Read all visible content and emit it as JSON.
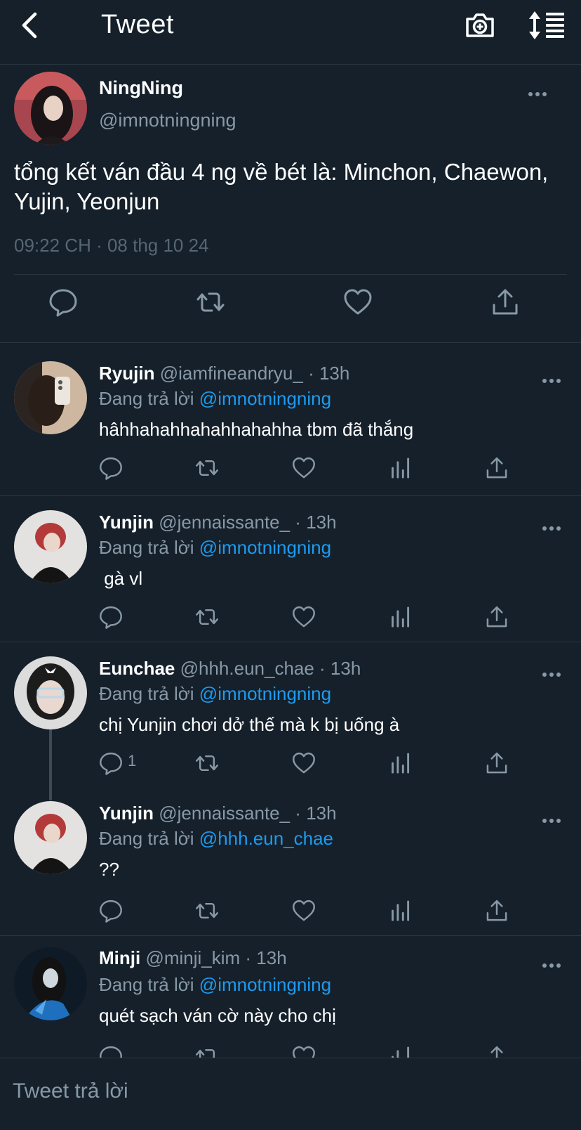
{
  "header": {
    "title": "Tweet"
  },
  "main_tweet": {
    "name": "NingNing",
    "handle": "@imnotningning",
    "text": "tổng kết ván đầu 4 ng về bét là: Minchon, Chaewon, Yujin, Yeonjun",
    "timestamp": "09:22 CH · 08 thg 10 24"
  },
  "replies": [
    {
      "name": "Ryujin",
      "meta": "@iamfineandryu_ · 13h",
      "replying_label": "Đang trả lời",
      "mention": "@imnotningning",
      "text": "hâhhahahhahahhahahha tbm đã thắng"
    },
    {
      "name": "Yunjin",
      "meta": "@jennaissante_ · 13h",
      "replying_label": "Đang trả lời",
      "mention": "@imnotningning",
      "text": " gà vl"
    },
    {
      "name": "Eunchae",
      "meta": "@hhh.eun_chae · 13h",
      "replying_label": "Đang trả lời",
      "mention": "@imnotningning",
      "text": "chị Yunjin chơi dở thế mà k bị uống à",
      "reply_count": "1"
    },
    {
      "name": "Yunjin",
      "meta": "@jennaissante_ · 13h",
      "replying_label": "Đang trả lời",
      "mention": "@hhh.eun_chae",
      "text": "??"
    },
    {
      "name": "Minji",
      "meta": "@minji_kim · 13h",
      "replying_label": "Đang trả lời",
      "mention": "@imnotningning",
      "text": "quét sạch ván cờ này cho chị"
    }
  ],
  "compose": {
    "placeholder": "Tweet trả lời"
  },
  "colors": {
    "background": "#15202b",
    "accent": "#1d9bf0",
    "muted": "#8899a6",
    "divider": "#2a3640"
  }
}
